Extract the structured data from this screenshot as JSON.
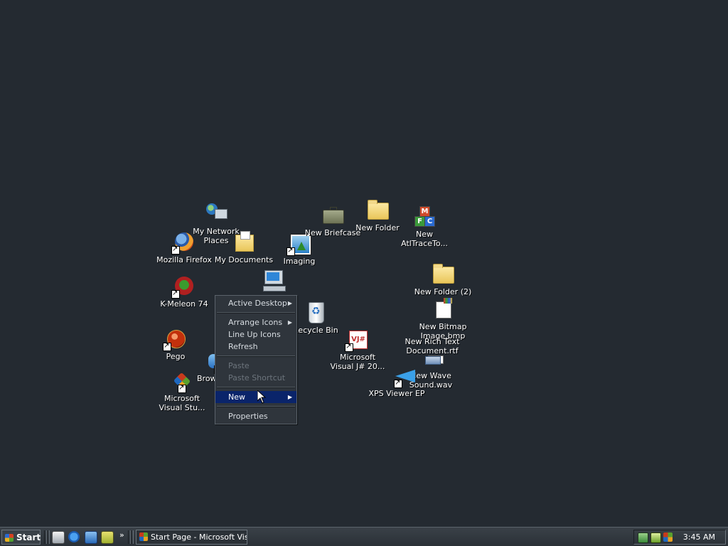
{
  "desktop": {
    "background_color": "#242a31",
    "icons": {
      "network_places": "My Network\nPlaces",
      "firefox": "Mozilla Firefox",
      "my_documents": "My Documents",
      "imaging": "Imaging",
      "new_briefcase": "New Briefcase",
      "new_folder": "New Folder",
      "atl_trace": "New\nAtlTraceTo...",
      "new_folder_2": "New Folder (2)",
      "kmeleon": "K-Meleon 74",
      "recycle_bin": "Recycle Bin",
      "new_bitmap": "New Bitmap\nImage.bmp",
      "new_rtf": "New Rich Text\nDocument.rtf",
      "pego": "Pego",
      "browser": "Brow",
      "visual_jsharp": "Microsoft\nVisual J# 20...",
      "new_wave": "New Wave\nSound.wav",
      "xps_viewer": "XPS Viewer EP",
      "visual_studio": "Microsoft\nVisual Stu..."
    }
  },
  "context_menu": {
    "active_desktop": "Active Desktop",
    "arrange_icons": "Arrange Icons",
    "line_up_icons": "Line Up Icons",
    "refresh": "Refresh",
    "paste": "Paste",
    "paste_shortcut": "Paste Shortcut",
    "new": "New",
    "properties": "Properties",
    "selected_item": "New"
  },
  "taskbar": {
    "start_label": "Start",
    "task_title": "Start Page - Microsoft Vis...",
    "overflow_glyph": "»",
    "clock": "3:45 AM",
    "quick_launch": [
      "show-desktop-icon",
      "internet-explorer-icon",
      "outlook-express-icon",
      "windows-media-icon"
    ],
    "tray_icons": [
      "network-icon",
      "volume-icon",
      "visual-studio-tray-icon"
    ]
  },
  "colors": {
    "menu_highlight": "#0a246a",
    "menu_background": "#2f353c",
    "disabled_text": "#6c747c"
  }
}
